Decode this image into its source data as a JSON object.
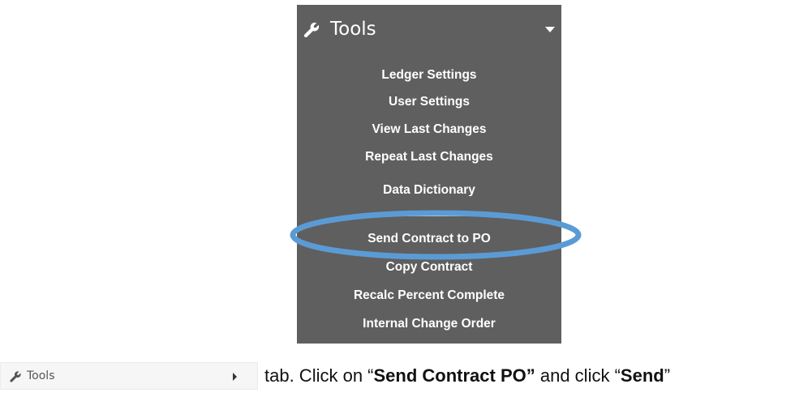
{
  "tools_menu": {
    "title": "Tools",
    "header_icon": "wrench-icon",
    "caret_icon": "caret-down-icon",
    "items": [
      {
        "label": "Ledger Settings"
      },
      {
        "label": "User Settings"
      },
      {
        "label": "View Last Changes"
      },
      {
        "label": "Repeat Last Changes"
      },
      {
        "label": "Data Dictionary"
      },
      {
        "label": "Send Contract to PO"
      },
      {
        "label": "Copy Contract"
      },
      {
        "label": "Recalc Percent Complete"
      },
      {
        "label": "Internal Change Order"
      }
    ],
    "highlight_color": "#5b9bd5",
    "background_color": "#5f5f5f"
  },
  "sidebar_tools_button": {
    "label": "Tools",
    "icon": "wrench-icon",
    "arrow_icon": "caret-right-icon"
  },
  "instruction": {
    "part1": "tab.  Click on “",
    "bold1": "Send Contract PO”",
    "part2": " and click “",
    "bold2": "Send",
    "part3": "”"
  }
}
